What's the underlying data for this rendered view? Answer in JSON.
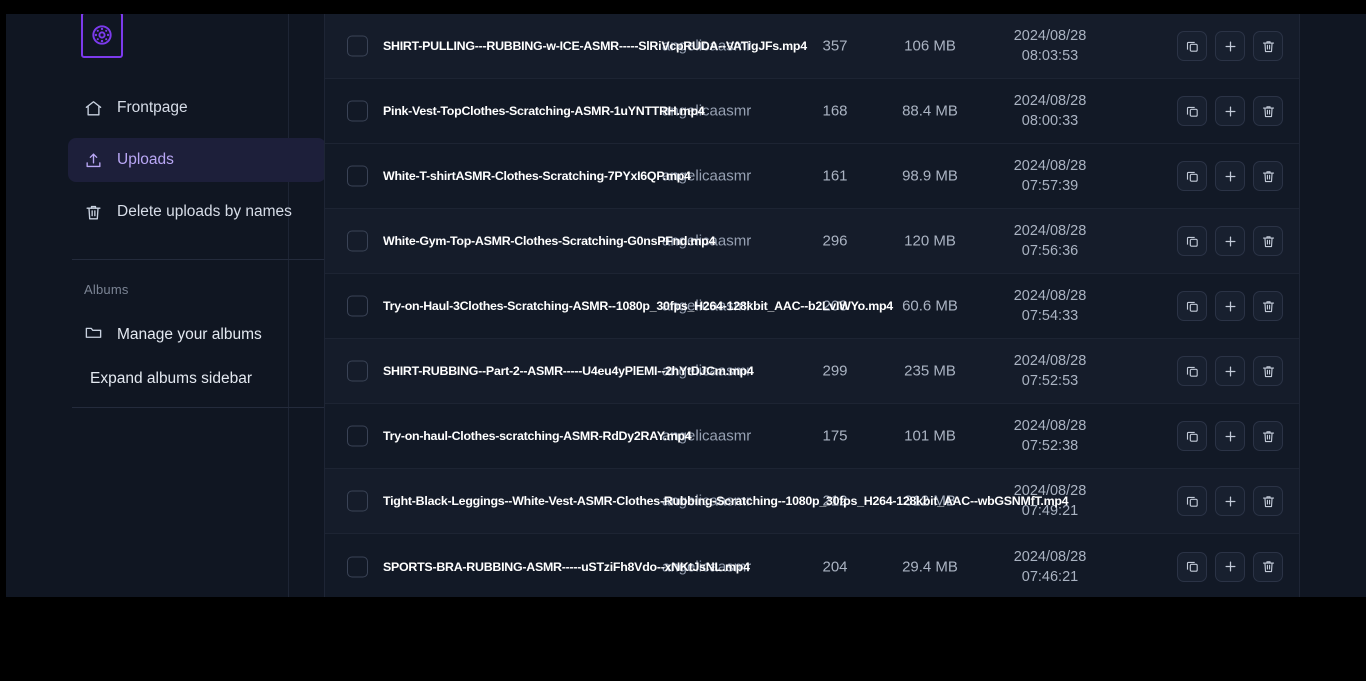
{
  "app": {
    "logo_icon": "film-reel-icon",
    "accent_color": "#7c3aed",
    "background_color": "#101622",
    "card_color": "#121926"
  },
  "sidebar": {
    "items": [
      {
        "label": "Frontpage",
        "icon": "home-icon",
        "active": false
      },
      {
        "label": "Uploads",
        "icon": "upload-icon",
        "active": true
      },
      {
        "label": "Delete uploads by names",
        "icon": "trash-icon",
        "active": false
      }
    ],
    "section_title": "Albums",
    "album_items": [
      {
        "label": "Manage your albums",
        "icon": "folder-icon"
      },
      {
        "label": "Expand albums sidebar",
        "icon": "none"
      }
    ]
  },
  "table": {
    "row_actions": [
      {
        "name": "copy-link-button",
        "icon": "copy-icon"
      },
      {
        "name": "add-to-album-button",
        "icon": "plus-icon"
      },
      {
        "name": "delete-upload-button",
        "icon": "trash-icon"
      }
    ],
    "rows": [
      {
        "filename": "SHIRT-PULLING---RUBBING-w-ICE-ASMR-----SlRiVcpRUDA--VATigJFs.mp4",
        "username": "angelicaasmr",
        "count": "357",
        "size": "106 MB",
        "date": "2024/08/28",
        "time": "08:03:53"
      },
      {
        "filename": "Pink-Vest-TopClothes-Scratching-ASMR-1uYNTTRH.mp4",
        "username": "angelicaasmr",
        "count": "168",
        "size": "88.4 MB",
        "date": "2024/08/28",
        "time": "08:00:33"
      },
      {
        "filename": "White-T-shirtASMR-Clothes-Scratching-7PYxI6QP.mp4",
        "username": "angelicaasmr",
        "count": "161",
        "size": "98.9 MB",
        "date": "2024/08/28",
        "time": "07:57:39"
      },
      {
        "filename": "White-Gym-Top-ASMR-Clothes-Scratching-G0nsPFnd.mp4",
        "username": "angelicaasmr",
        "count": "296",
        "size": "120 MB",
        "date": "2024/08/28",
        "time": "07:56:36"
      },
      {
        "filename": "Try-on-Haul-3Clothes-Scratching-ASMR--1080p_30fps_H264-128kbit_AAC--b2LvIWYo.mp4",
        "username": "angelicaasmr",
        "count": "208",
        "size": "60.6 MB",
        "date": "2024/08/28",
        "time": "07:54:33"
      },
      {
        "filename": "SHIRT-RUBBING--Part-2--ASMR-----U4eu4yPlEMI--2hYtDJCm.mp4",
        "username": "angelicaasmr",
        "count": "299",
        "size": "235 MB",
        "date": "2024/08/28",
        "time": "07:52:53"
      },
      {
        "filename": "Try-on-haul-Clothes-scratching-ASMR-RdDy2RAY.mp4",
        "username": "angelicaasmr",
        "count": "175",
        "size": "101 MB",
        "date": "2024/08/28",
        "time": "07:52:38"
      },
      {
        "filename": "Tight-Black-Leggings--White-Vest-ASMR-Clothes-Rubbing-Scratching--1080p_30fps_H264-128kbit_AAC--wbGSNMfT.mp4",
        "username": "angelicaasmr",
        "count": "212",
        "size": "312 MB",
        "date": "2024/08/28",
        "time": "07:49:21"
      },
      {
        "filename": "SPORTS-BRA-RUBBING-ASMR-----uSTziFh8Vdo--xNKtJsNL.mp4",
        "username": "angelicaasmr",
        "count": "204",
        "size": "29.4 MB",
        "date": "2024/08/28",
        "time": "07:46:21"
      }
    ]
  }
}
